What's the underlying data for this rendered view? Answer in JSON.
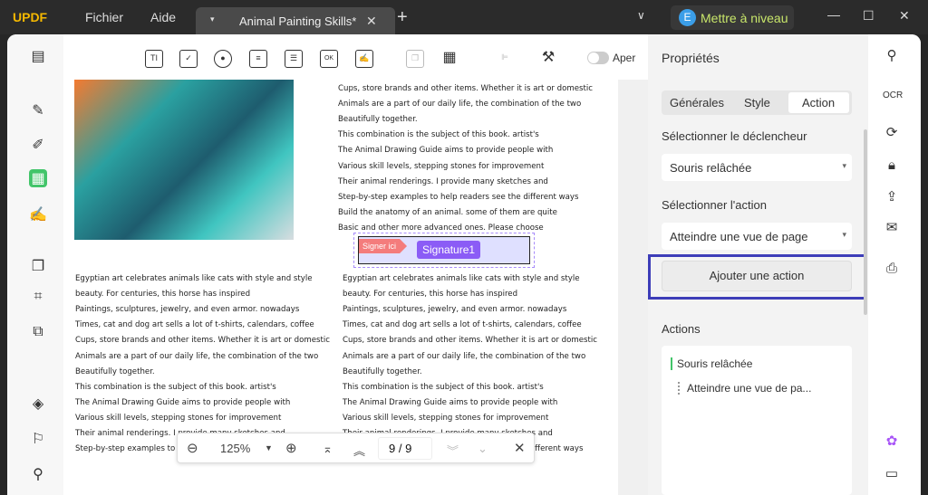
{
  "titlebar": {
    "logo": "UPDF",
    "menu": [
      "Fichier",
      "Aide"
    ],
    "tab_title": "Animal Painting Skills*",
    "upgrade": "Mettre à niveau",
    "avatar": "E"
  },
  "toolbar": {
    "ti": "TI",
    "ok": "OK",
    "preview": "Aper"
  },
  "document": {
    "right_top": [
      "Cups, store brands and other items. Whether it is art or domestic",
      "Animals are a part of our daily life, the combination of the two",
      "Beautifully together.",
      "This combination is the subject of this book. artist's",
      "The Animal Drawing Guide aims to provide people with",
      "Various skill levels, stepping stones for improvement",
      "Their animal renderings. I provide many sketches and",
      "Step-by-step examples to help readers see the different ways",
      "Build the anatomy of an animal. some of them are quite",
      "Basic and other more advanced ones. Please choose"
    ],
    "left_bottom": [
      "Egyptian art celebrates animals like cats with style and style",
      "beauty. For centuries, this horse has inspired",
      "Paintings, sculptures, jewelry, and even armor. nowadays",
      "Times, cat and dog art sells a lot of t-shirts, calendars, coffee",
      "Cups, store brands and other items. Whether it is art or domestic",
      "Animals are a part of our daily life, the combination of the two",
      "Beautifully together.",
      "This combination is the subject of this book. artist's",
      "The Animal Drawing Guide aims to provide people with",
      "Various skill levels, stepping stones for improvement",
      "Their animal renderings. I provide many sketches and",
      "Step-by-step examples to help readers see the different ways"
    ],
    "right_bottom": [
      "Egyptian art celebrates animals like cats with style and style",
      "beauty. For centuries, this horse has inspired",
      "Paintings, sculptures, jewelry, and even armor. nowadays",
      "Times, cat and dog art sells a lot of t-shirts, calendars, coffee",
      "Cups, store brands and other items. Whether it is art or domestic",
      "Animals are a part of our daily life, the combination of the two",
      "Beautifully together.",
      "This combination is the subject of this book. artist's",
      "The Animal Drawing Guide aims to provide people with",
      "Various skill levels, stepping stones for improvement",
      "Their animal renderings. I provide many sketches and",
      "Step-by-step examples to help readers see the different ways"
    ],
    "signer_tag": "Signer ici",
    "signature_field": "Signature1"
  },
  "zoombar": {
    "zoom": "125%",
    "page": "9 / 9"
  },
  "props": {
    "title": "Propriétés",
    "tabs": [
      "Générales",
      "Style",
      "Action"
    ],
    "trigger_label": "Sélectionner le déclencheur",
    "trigger_value": "Souris relâchée",
    "action_label": "Sélectionner l'action",
    "action_value": "Atteindre une vue de page",
    "add_button": "Ajouter une action",
    "actions_label": "Actions",
    "actions_list": [
      "Souris relâchée",
      "Atteindre une vue de pa..."
    ]
  }
}
